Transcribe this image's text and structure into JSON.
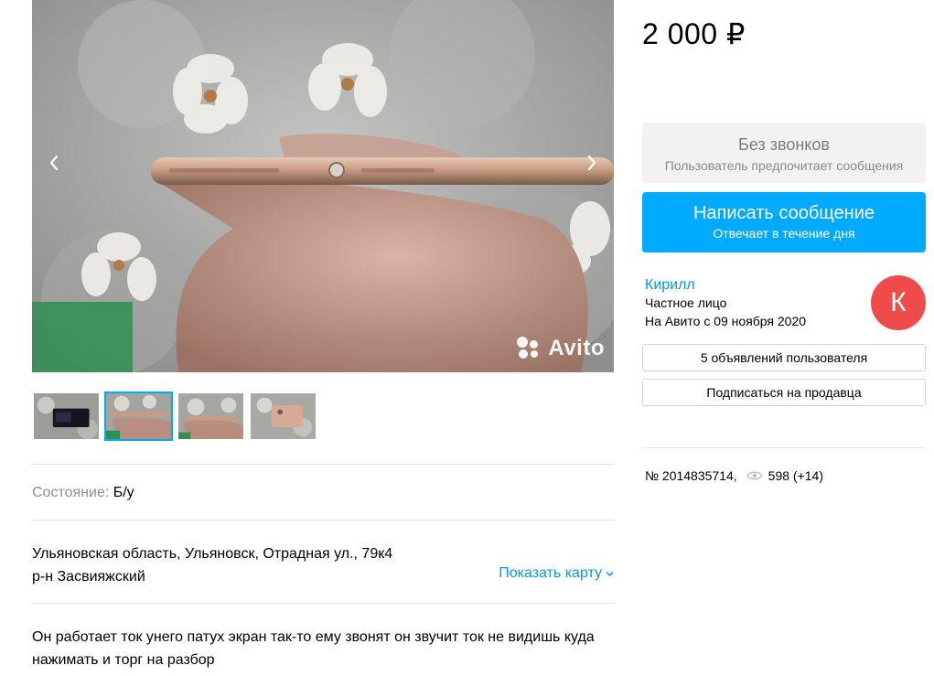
{
  "gallery": {
    "watermark": "Avito",
    "prev_icon": "chevron-left-icon",
    "next_icon": "chevron-right-icon",
    "active_index": 1,
    "thumbnail_count": 4
  },
  "listing": {
    "condition_label": "Состояние:",
    "condition_value": "Б/у",
    "address_line1": "Ульяновская область, Ульяновск, Отрадная ул., 79к4",
    "address_line2": "р-н Засвияжский",
    "show_map": "Показать карту",
    "description_line1": "Он работает ток унего патух экран так-то ему звонят он звучит ток не видишь куда",
    "description_line2": "нажимать и торг на разбор"
  },
  "sidebar": {
    "price": "2 000 ₽",
    "no_calls_title": "Без звонков",
    "no_calls_subtitle": "Пользователь предпочитает сообщения",
    "write_title": "Написать сообщение",
    "write_subtitle": "Отвечает в течение дня",
    "seller_name": "Кирилл",
    "seller_type": "Частное лицо",
    "seller_since": "На Авито с 09 ноября 2020",
    "avatar_letter": "К",
    "listings_button": "5 объявлений пользователя",
    "subscribe_button": "Подписаться на продавца",
    "ad_number": "№ 2014835714,",
    "views": "598 (+14)"
  },
  "colors": {
    "accent": "#00aaff",
    "link": "#0099e5",
    "avatar_bg": "#f04b4b",
    "muted_bg": "#f2f2f2"
  }
}
